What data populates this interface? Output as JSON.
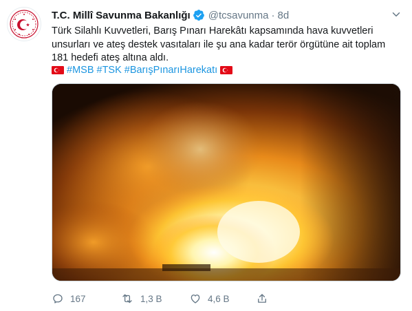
{
  "tweet": {
    "display_name": "T.C. Millî Savunma Bakanlığı",
    "handle": "@tcsavunma",
    "separator": "·",
    "time": "8d",
    "text_lines": [
      "Türk Silahlı Kuvvetleri, Barış Pınarı Harekâtı kapsamında hava kuvvetleri",
      "unsurları ve ateş destek vasıtaları ile şu ana kadar terör örgütüne ait toplam",
      "181 hedefi ateş altına aldı."
    ],
    "hashtags": [
      "#MSB",
      "#TSK",
      "#BarışPınarıHarekatı"
    ],
    "reply_count": "167",
    "retweet_count": "1,3 B",
    "like_count": "4,6 B"
  },
  "colors": {
    "accent": "#1b95e0",
    "muted": "#657786",
    "verified": "#1da1f2",
    "flag_red": "#e30a17",
    "logo_red": "#c8102e"
  },
  "icons": {
    "avatar": "ministry-emblem-icon",
    "verified": "verified-badge-icon",
    "menu": "chevron-down-icon",
    "flag": "turkish-flag-icon",
    "reply": "reply-icon",
    "retweet": "retweet-icon",
    "like": "heart-icon",
    "share": "share-icon"
  }
}
